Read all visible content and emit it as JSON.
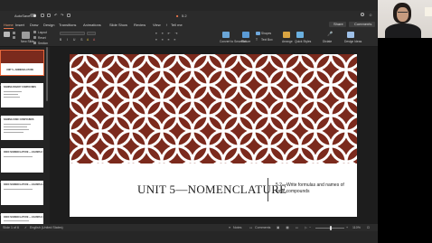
{
  "titlebar": {
    "autosave_label": "AutoSave",
    "autosave_state": "ON",
    "filename": "5.2",
    "tell_me": "Tell me"
  },
  "tabs": [
    {
      "label": "Home",
      "active": true
    },
    {
      "label": "Insert",
      "active": false
    },
    {
      "label": "Draw",
      "active": false
    },
    {
      "label": "Design",
      "active": false
    },
    {
      "label": "Transitions",
      "active": false
    },
    {
      "label": "Animations",
      "active": false
    },
    {
      "label": "Slide Show",
      "active": false
    },
    {
      "label": "Review",
      "active": false
    },
    {
      "label": "View",
      "active": false
    }
  ],
  "share_label": "Share",
  "comments_label": "Comments",
  "ribbon": {
    "new_slide": "New Slide",
    "layout": "Layout",
    "reset": "Reset",
    "section": "Section",
    "convert_smartart": "Convert to SmartArt",
    "picture": "Picture",
    "shapes": "Shapes",
    "text_box": "Text Box",
    "arrange": "Arrange",
    "quick_styles": "Quick Styles",
    "dictate": "Dictate",
    "design_ideas": "Design Ideas"
  },
  "thumbnails": [
    {
      "num": "1",
      "title": "UNIT 5—NOMENCLATURE",
      "selected": true
    },
    {
      "num": "2",
      "title": "NAMING BINARY COMPOUNDS",
      "selected": false
    },
    {
      "num": "3",
      "title": "NAMING IONIC COMPOUNDS",
      "selected": false
    },
    {
      "num": "4",
      "title": "IONIC NOMENCLATURE — EXAMPLE 1",
      "selected": false
    },
    {
      "num": "5",
      "title": "IONIC NOMENCLATURE — EXAMPLE 2",
      "selected": false
    },
    {
      "num": "6",
      "title": "IONIC NOMENCLATURE — EXAMPLE 3",
      "selected": false
    }
  ],
  "slide": {
    "title": "UNIT 5—NOMENCLATURE",
    "subtitle": "5.2—Write formulas and names of ionic compounds",
    "pattern_color": "#7b2a1d"
  },
  "status": {
    "slide_of": "Slide 1 of 6",
    "language": "English (United States)",
    "notes": "Notes",
    "comments": "Comments",
    "zoom": "110%"
  }
}
